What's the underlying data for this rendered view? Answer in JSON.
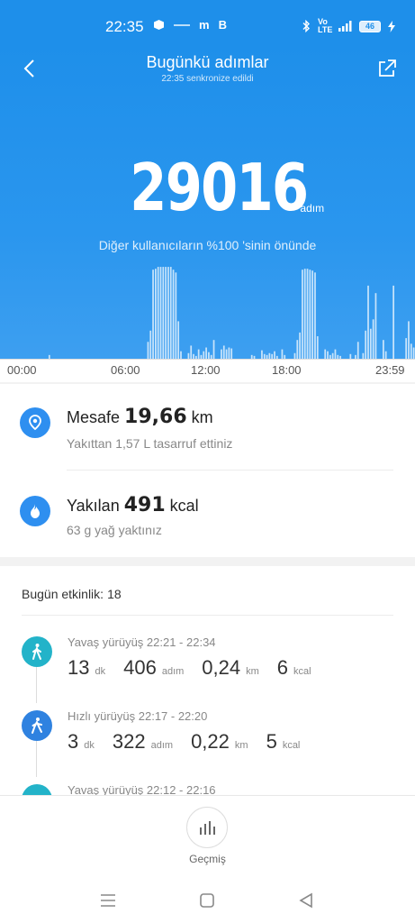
{
  "status_bar": {
    "time": "22:35",
    "left_icons": [
      "package-icon",
      "signal-text-icon",
      "m-icon",
      "b-icon"
    ],
    "left_text": [
      "m",
      "B"
    ],
    "net_label": "Vo LTE",
    "battery": "46"
  },
  "header": {
    "title": "Bugünkü adımlar",
    "subtitle": "22:35 senkronize edildi",
    "steps": "29016",
    "steps_unit": "adım",
    "caption": "Diğer kullanıcıların %100 'sinin önünde"
  },
  "axis_labels": [
    "00:00",
    "06:00",
    "12:00",
    "18:00",
    "23:59"
  ],
  "chart_data": {
    "type": "bar",
    "x_range": [
      "00:00",
      "23:59"
    ],
    "values": [
      0,
      0,
      0,
      0,
      0,
      0,
      0,
      0,
      0,
      0,
      0,
      0,
      0,
      0,
      0,
      0,
      0,
      0,
      0,
      4,
      0,
      0,
      0,
      0,
      0,
      0,
      0,
      0,
      0,
      0,
      0,
      0,
      0,
      0,
      0,
      0,
      0,
      0,
      0,
      0,
      0,
      0,
      0,
      0,
      0,
      0,
      0,
      0,
      0,
      0,
      0,
      0,
      0,
      0,
      0,
      0,
      0,
      0,
      18,
      30,
      95,
      96,
      98,
      98,
      98,
      98,
      98,
      98,
      95,
      92,
      40,
      8,
      0,
      0,
      6,
      14,
      5,
      3,
      10,
      4,
      8,
      12,
      7,
      4,
      20,
      0,
      0,
      10,
      14,
      10,
      12,
      11,
      0,
      0,
      0,
      0,
      0,
      0,
      0,
      4,
      3,
      0,
      0,
      9,
      5,
      4,
      6,
      5,
      8,
      3,
      0,
      10,
      4,
      0,
      0,
      0,
      6,
      20,
      28,
      95,
      96,
      96,
      95,
      94,
      92,
      24,
      0,
      0,
      10,
      8,
      4,
      6,
      10,
      4,
      3,
      0,
      0,
      0,
      5,
      0,
      4,
      18,
      0,
      6,
      30,
      78,
      32,
      42,
      70,
      0,
      0,
      20,
      8,
      0,
      0,
      78,
      0,
      0,
      0,
      0,
      22,
      40,
      16,
      12
    ],
    "ylim": [
      0,
      100
    ]
  },
  "stats": [
    {
      "label": "Mesafe",
      "value": "19,66",
      "unit": "km",
      "sub": "Yakıttan 1,57 L tasarruf ettiniz",
      "icon": "location-icon",
      "color": "#2e8ff0"
    },
    {
      "label": "Yakılan",
      "value": "491",
      "unit": "kcal",
      "sub": "63 g yağ yaktınız",
      "icon": "flame-icon",
      "color": "#2e8ff0"
    }
  ],
  "activity": {
    "label": "Bugün etkinlik:",
    "count": "18",
    "items": [
      {
        "title": "Yavaş yürüyüş 22:21 - 22:34",
        "min": "13",
        "min_unit": "dk",
        "steps": "406",
        "steps_unit": "adım",
        "km": "0,24",
        "km_unit": "km",
        "kcal": "6",
        "kcal_unit": "kcal",
        "color": "#23b3c9",
        "icon": "walk-icon"
      },
      {
        "title": "Hızlı yürüyüş 22:17 - 22:20",
        "min": "3",
        "min_unit": "dk",
        "steps": "322",
        "steps_unit": "adım",
        "km": "0,22",
        "km_unit": "km",
        "kcal": "5",
        "kcal_unit": "kcal",
        "color": "#2f82e0",
        "icon": "fast-walk-icon"
      },
      {
        "title": "Yavaş yürüyüş 22:12 - 22:16",
        "color": "#23b3c9",
        "icon": "walk-icon"
      }
    ]
  },
  "bottom": {
    "history_label": "Geçmiş"
  }
}
